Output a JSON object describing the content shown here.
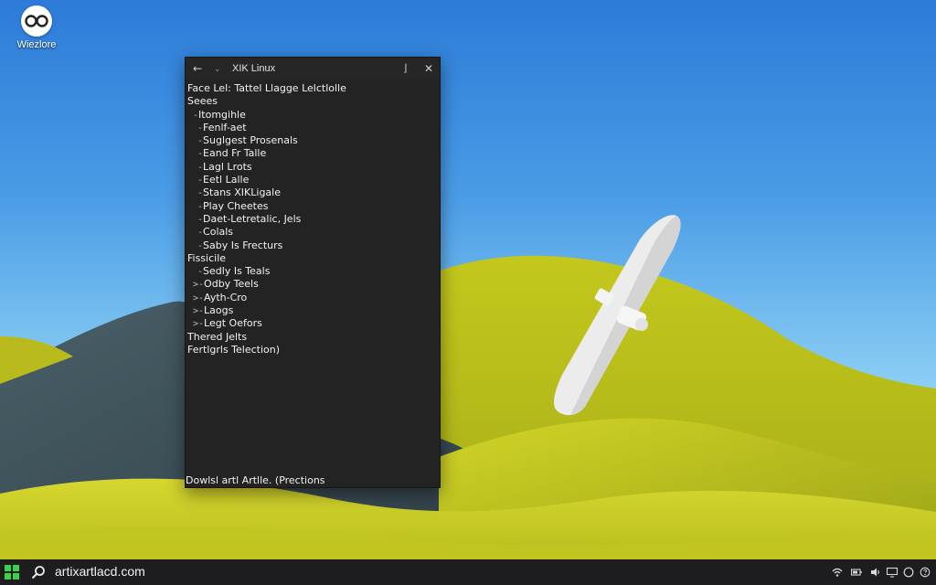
{
  "desktop": {
    "icon_label": "Wiezlore",
    "icon_glyph": "OO"
  },
  "window": {
    "title": "XIK Linux",
    "back_glyph": "←",
    "dropdown_glyph": "⌄",
    "minimize_glyph": "⌋",
    "close_glyph": "✕",
    "tree": [
      {
        "prefix": "",
        "text": "Face Lel: Tattel Llagge Lelctlolle",
        "level": 0
      },
      {
        "prefix": "",
        "text": "Seees",
        "level": 0
      },
      {
        "prefix": "-",
        "text": "Itomgihle",
        "level": 1
      },
      {
        "prefix": "-",
        "text": "Fenlf-aet",
        "level": 2
      },
      {
        "prefix": "-",
        "text": "Suglgest Prosenals",
        "level": 2
      },
      {
        "prefix": "-",
        "text": "Eand Fr Talle",
        "level": 2
      },
      {
        "prefix": "-",
        "text": "Lagl Lrots",
        "level": 2
      },
      {
        "prefix": "-",
        "text": "Eetl Lalle",
        "level": 2
      },
      {
        "prefix": "-",
        "text": "Stans XIKLigale",
        "level": 2
      },
      {
        "prefix": "-",
        "text": "Play Cheetes",
        "level": 2
      },
      {
        "prefix": "-",
        "text": "Daet-Letretalic, Jels",
        "level": 2
      },
      {
        "prefix": "-",
        "text": "Colals",
        "level": 2
      },
      {
        "prefix": "-",
        "text": "Saby Is Frecturs",
        "level": 2
      },
      {
        "prefix": "",
        "text": "Fissicile",
        "level": 0
      },
      {
        "prefix": "-",
        "text": "Sedly Is Teals",
        "level": 2
      },
      {
        "prefix": ">-",
        "text": "Odby Teels",
        "level": 1
      },
      {
        "prefix": ">-",
        "text": "Ayth-Cro",
        "level": 1
      },
      {
        "prefix": ">-",
        "text": "Laogs",
        "level": 1
      },
      {
        "prefix": ">-",
        "text": "Legt Oefors",
        "level": 1
      },
      {
        "prefix": "",
        "text": "Thered Jelts",
        "level": 0
      },
      {
        "prefix": "",
        "text": "Fertlgrls Telection)",
        "level": 0
      }
    ],
    "status_text": "Dowlsl artl Artlle. (Prections"
  },
  "taskbar": {
    "search_text": "artixartlacd.com",
    "tray_icons": [
      "wifi-icon",
      "battery-icon",
      "volume-icon",
      "display-icon",
      "power-icon",
      "help-icon"
    ]
  },
  "colors": {
    "sky_top": "#2f7fd9",
    "sky_bottom": "#8cd2f6",
    "hill_yellow": "#c9cc1e",
    "hill_dark": "#3b4e55",
    "terminal_bg": "#232323",
    "taskbar_bg": "#1d1d1f"
  }
}
